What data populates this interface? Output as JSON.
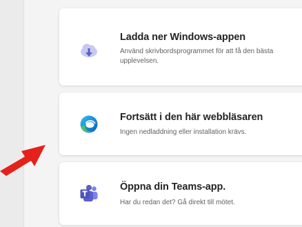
{
  "options": [
    {
      "title": "Ladda ner Windows-appen",
      "description": "Använd skrivbordsprogrammet för att få den bästa upplevelsen.",
      "icon": "cloud-download-icon"
    },
    {
      "title": "Fortsätt i den här webbläsaren",
      "description": "Ingen nedladdning eller installation krävs.",
      "icon": "edge-browser-icon"
    },
    {
      "title": "Öppna din Teams-app.",
      "description": "Har du redan det? Gå direkt till mötet.",
      "icon": "teams-icon"
    }
  ],
  "colors": {
    "annotation_arrow": "#e5211b",
    "teams_purple": "#5b5fc7",
    "cloud_lavender": "#c7c9ef"
  }
}
